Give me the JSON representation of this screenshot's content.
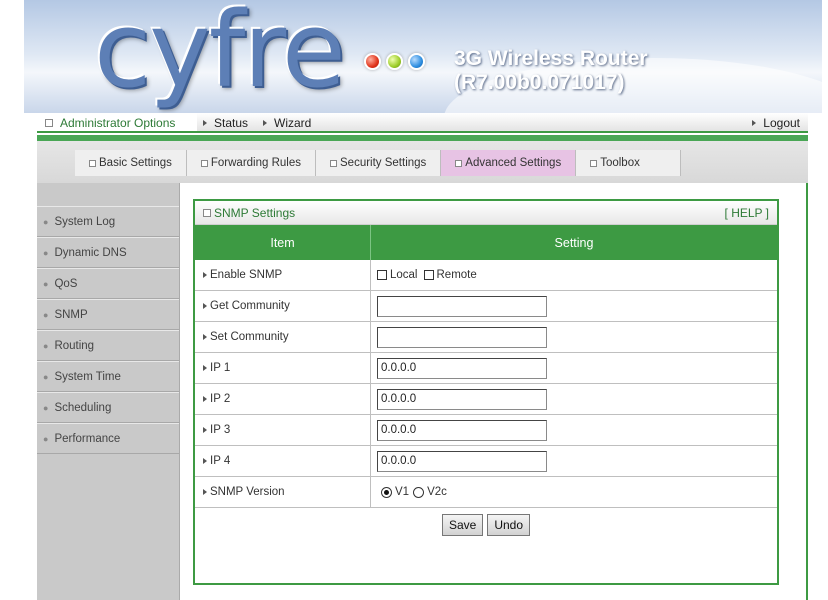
{
  "header": {
    "logo_text": "cyfre",
    "product_title": "3G Wireless Router (R7.00b0.071017)"
  },
  "topnav": {
    "admin_label": "Administrator Options",
    "status_label": "Status",
    "wizard_label": "Wizard",
    "logout_label": "Logout"
  },
  "tabs": [
    {
      "label": "Basic Settings",
      "active": false
    },
    {
      "label": "Forwarding Rules",
      "active": false
    },
    {
      "label": "Security Settings",
      "active": false
    },
    {
      "label": "Advanced Settings",
      "active": true
    },
    {
      "label": "Toolbox",
      "active": false
    }
  ],
  "sidebar": {
    "items": [
      {
        "label": "System Log"
      },
      {
        "label": "Dynamic DNS"
      },
      {
        "label": "QoS"
      },
      {
        "label": "SNMP"
      },
      {
        "label": "Routing"
      },
      {
        "label": "System Time"
      },
      {
        "label": "Scheduling"
      },
      {
        "label": "Performance"
      }
    ]
  },
  "panel": {
    "title": "SNMP Settings",
    "help": "[ HELP ]",
    "col_item": "Item",
    "col_setting": "Setting"
  },
  "form": {
    "enable_snmp": {
      "label": "Enable SNMP",
      "local_label": "Local",
      "remote_label": "Remote",
      "local_checked": false,
      "remote_checked": false
    },
    "get_community": {
      "label": "Get Community",
      "value": ""
    },
    "set_community": {
      "label": "Set Community",
      "value": ""
    },
    "ip1": {
      "label": "IP 1",
      "value": "0.0.0.0"
    },
    "ip2": {
      "label": "IP 2",
      "value": "0.0.0.0"
    },
    "ip3": {
      "label": "IP 3",
      "value": "0.0.0.0"
    },
    "ip4": {
      "label": "IP 4",
      "value": "0.0.0.0"
    },
    "snmp_version": {
      "label": "SNMP Version",
      "v1_label": "V1",
      "v2c_label": "V2c",
      "selected": "V1"
    }
  },
  "buttons": {
    "save_label": "Save",
    "undo_label": "Undo"
  },
  "colors": {
    "accent_green": "#3d9a43",
    "active_tab": "#e7c3e4",
    "logo_blue": "#5d7fb6"
  }
}
